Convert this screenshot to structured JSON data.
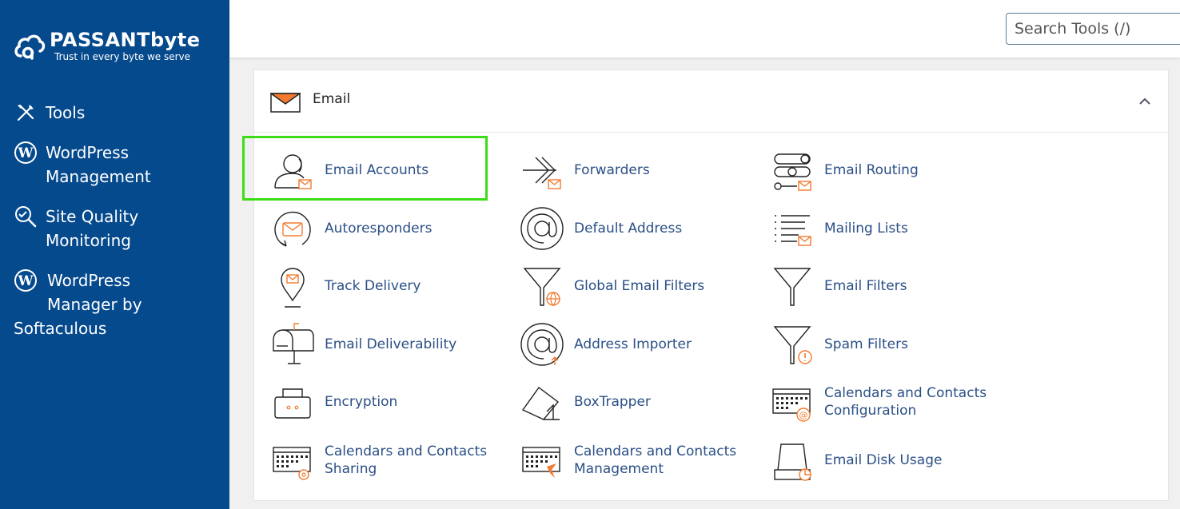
{
  "brand": {
    "name": "PASSANTbyte",
    "tagline": "Trust in every byte we serve"
  },
  "sidebar": {
    "items": [
      {
        "label": "Tools",
        "icon": "tools-icon"
      },
      {
        "label": "WordPress\nManagement",
        "icon": "wordpress-icon"
      },
      {
        "label": "Site Quality\nMonitoring",
        "icon": "site-quality-icon"
      },
      {
        "label": "WordPress\nManager by",
        "label_tail": "Softaculous",
        "icon": "wordpress-icon"
      }
    ]
  },
  "search": {
    "placeholder": "Search Tools (/)"
  },
  "section": {
    "title": "Email",
    "icon": "envelope-icon",
    "state": "expanded"
  },
  "tools": [
    [
      "Email Accounts",
      "Forwarders",
      "Email Routing"
    ],
    [
      "Autoresponders",
      "Default Address",
      "Mailing Lists"
    ],
    [
      "Track Delivery",
      "Global Email Filters",
      "Email Filters"
    ],
    [
      "Email Deliverability",
      "Address Importer",
      "Spam Filters"
    ],
    [
      "Encryption",
      "BoxTrapper",
      "Calendars and Contacts\nConfiguration"
    ],
    [
      "Calendars and Contacts\nSharing",
      "Calendars and Contacts\nManagement",
      "Email Disk Usage"
    ]
  ],
  "colors": {
    "sidebar": "#064a8e",
    "accent": "#f37a2e",
    "link": "#2a4f86",
    "highlight": "#3cdc17"
  }
}
